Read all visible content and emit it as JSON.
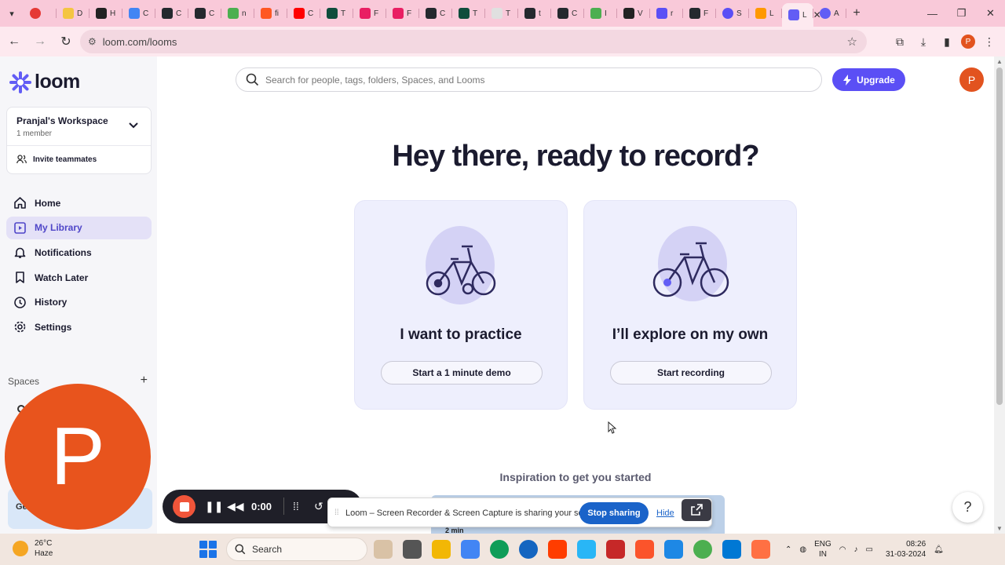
{
  "browser": {
    "tab_favicon_colors": [
      "#e53935",
      "#f4c542",
      "#222222",
      "#4285f4",
      "#24292e",
      "#24292e",
      "#4caf50",
      "#ff5722",
      "#ff0000",
      "#0f4d3c",
      "#e91e63",
      "#e91e63",
      "#24292e",
      "#0f4d3c",
      "#e0e0e0",
      "#24292e",
      "#24292e",
      "#4caf50",
      "#222222",
      "#5b4ff5",
      "#24292e",
      "#5b4ff5",
      "#ff9800",
      "#625df5",
      "#625df5"
    ],
    "tab_letters": [
      "",
      "D",
      "H",
      "C",
      "C",
      "C",
      "n",
      "fi",
      "C",
      "T",
      "F",
      "F",
      "C",
      "T",
      "T",
      "t",
      "C",
      "I",
      "V",
      "r",
      "F",
      "S",
      "L",
      "",
      "A"
    ],
    "active_tab_label": "L",
    "url": "loom.com/looms"
  },
  "app": {
    "logo_text": "loom",
    "brand_color": "#625df5",
    "workspace": {
      "name": "Pranjal's Workspace",
      "members": "1 member",
      "invite_label": "Invite teammates"
    },
    "nav": [
      {
        "label": "Home",
        "icon": "home-icon"
      },
      {
        "label": "My Library",
        "icon": "library-icon"
      },
      {
        "label": "Notifications",
        "icon": "bell-icon"
      },
      {
        "label": "Watch Later",
        "icon": "bookmark-icon"
      },
      {
        "label": "History",
        "icon": "clock-icon"
      },
      {
        "label": "Settings",
        "icon": "gear-icon"
      }
    ],
    "spaces_label": "Spaces",
    "side_bottom_label": "Ge",
    "search_placeholder": "Search for people, tags, folders, Spaces, and Looms",
    "upgrade_label": "Upgrade",
    "avatar_initial": "P",
    "hero_title": "Hey there, ready to record?",
    "cards": [
      {
        "title": "I want to practice",
        "button": "Start a 1 minute demo"
      },
      {
        "title": "I’ll explore on my own",
        "button": "Start recording"
      }
    ],
    "inspiration_label": "Inspiration to get you started",
    "thumb_label": "2 min",
    "help_label": "?"
  },
  "overlay": {
    "big_avatar_initial": "P",
    "recorder_time": "0:00",
    "share_text": "Loom – Screen Recorder & Screen Capture is sharing your screen.",
    "stop_sharing_label": "Stop sharing",
    "hide_label": "Hide"
  },
  "taskbar": {
    "temperature": "26°C",
    "weather": "Haze",
    "search_label": "Search",
    "app_colors": [
      "#d9c2a6",
      "#555555",
      "#f2b705",
      "#4285f4",
      "#0f9d58",
      "#1565c0",
      "#ff3d00",
      "#29b6f6",
      "#c62828",
      "#fb542b",
      "#1e88e5",
      "#4caf50",
      "#0078d4",
      "#ff7043"
    ],
    "lang_1": "ENG",
    "lang_2": "IN",
    "time": "08:26",
    "date": "31-03-2024"
  }
}
